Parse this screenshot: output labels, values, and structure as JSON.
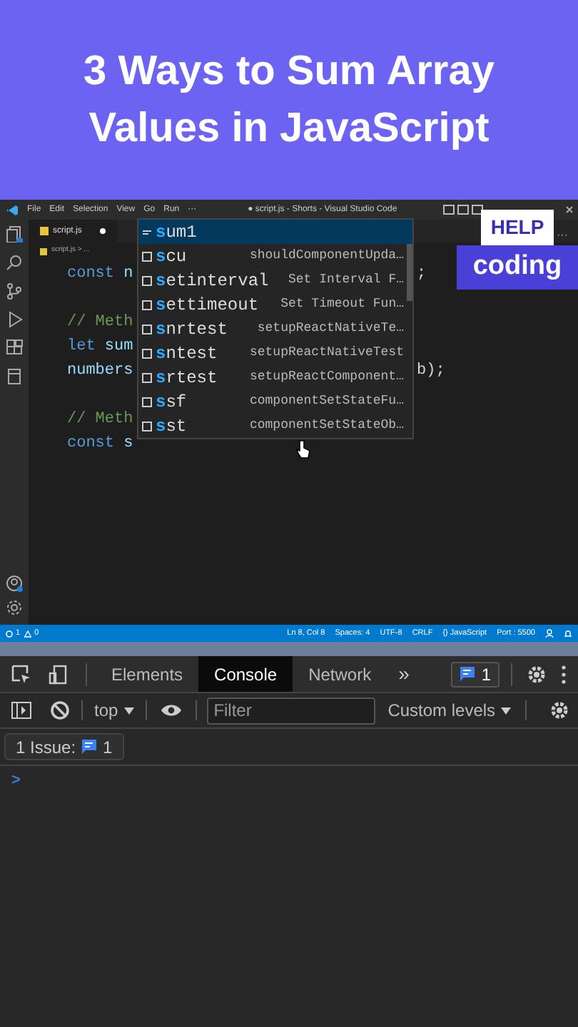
{
  "header": {
    "title": "3 Ways to Sum Array Values in JavaScript"
  },
  "vscode": {
    "menu": [
      "File",
      "Edit",
      "Selection",
      "View",
      "Go",
      "Run",
      "···"
    ],
    "window_title": "● script.js - Shorts - Visual Studio Code",
    "tab": {
      "label": "script.js",
      "modified": true
    },
    "breadcrumb": "script.js > ...",
    "code_lines": [
      {
        "kind": "code",
        "tokens": [
          {
            "text": "const",
            "kind": "keyword"
          },
          {
            "text": " n",
            "kind": "ident"
          }
        ],
        "after": ";"
      },
      {
        "kind": "blank"
      },
      {
        "kind": "code",
        "tokens": [
          {
            "text": "// Meth",
            "kind": "comment"
          }
        ]
      },
      {
        "kind": "code",
        "tokens": [
          {
            "text": "let",
            "kind": "keyword"
          },
          {
            "text": " sum",
            "kind": "ident"
          }
        ]
      },
      {
        "kind": "code",
        "tokens": [
          {
            "text": "numbers",
            "kind": "ident"
          }
        ],
        "after": "b);"
      },
      {
        "kind": "blank"
      },
      {
        "kind": "code",
        "tokens": [
          {
            "text": "// Meth",
            "kind": "comment"
          }
        ]
      },
      {
        "kind": "code",
        "tokens": [
          {
            "text": "const",
            "kind": "keyword"
          },
          {
            "text": " s",
            "kind": "ident"
          }
        ]
      }
    ],
    "suggestions": [
      {
        "label": "sum1",
        "kind": "word",
        "selected": true
      },
      {
        "label": "scu",
        "detail": "shouldComponentUpda…",
        "kind": "snippet",
        "selected": false
      },
      {
        "label": "setinterval",
        "detail": "Set Interval F…",
        "kind": "snippet",
        "selected": false
      },
      {
        "label": "settimeout",
        "detail": "Set Timeout Fun…",
        "kind": "snippet",
        "selected": false
      },
      {
        "label": "snrtest",
        "detail": "setupReactNativeTe…",
        "kind": "snippet",
        "selected": false
      },
      {
        "label": "sntest",
        "detail": "setupReactNativeTest",
        "kind": "snippet",
        "selected": false
      },
      {
        "label": "srtest",
        "detail": "setupReactComponent…",
        "kind": "snippet",
        "selected": false
      },
      {
        "label": "ssf",
        "detail": "componentSetStateFu…",
        "kind": "snippet",
        "selected": false
      },
      {
        "label": "sst",
        "detail": "componentSetStateOb…",
        "kind": "snippet",
        "selected": false
      }
    ],
    "more_actions": "···",
    "status_bar": {
      "errors": "1",
      "warnings": "0",
      "items": [
        "Ln 8, Col 8",
        "Spaces: 4",
        "UTF-8",
        "CRLF",
        "{} JavaScript",
        "Port : 5500"
      ]
    }
  },
  "badges": {
    "help": "HELP",
    "topic": "coding"
  },
  "devtools": {
    "tabs": [
      {
        "label": "Elements",
        "selected": false
      },
      {
        "label": "Console",
        "selected": true
      },
      {
        "label": "Network",
        "selected": false
      }
    ],
    "more_tabs": "»",
    "messages_count": "1",
    "context": "top",
    "filter_placeholder": "Filter",
    "levels": "Custom levels",
    "issues_label": "1 Issue:",
    "issues_count": "1",
    "prompt": ">"
  }
}
